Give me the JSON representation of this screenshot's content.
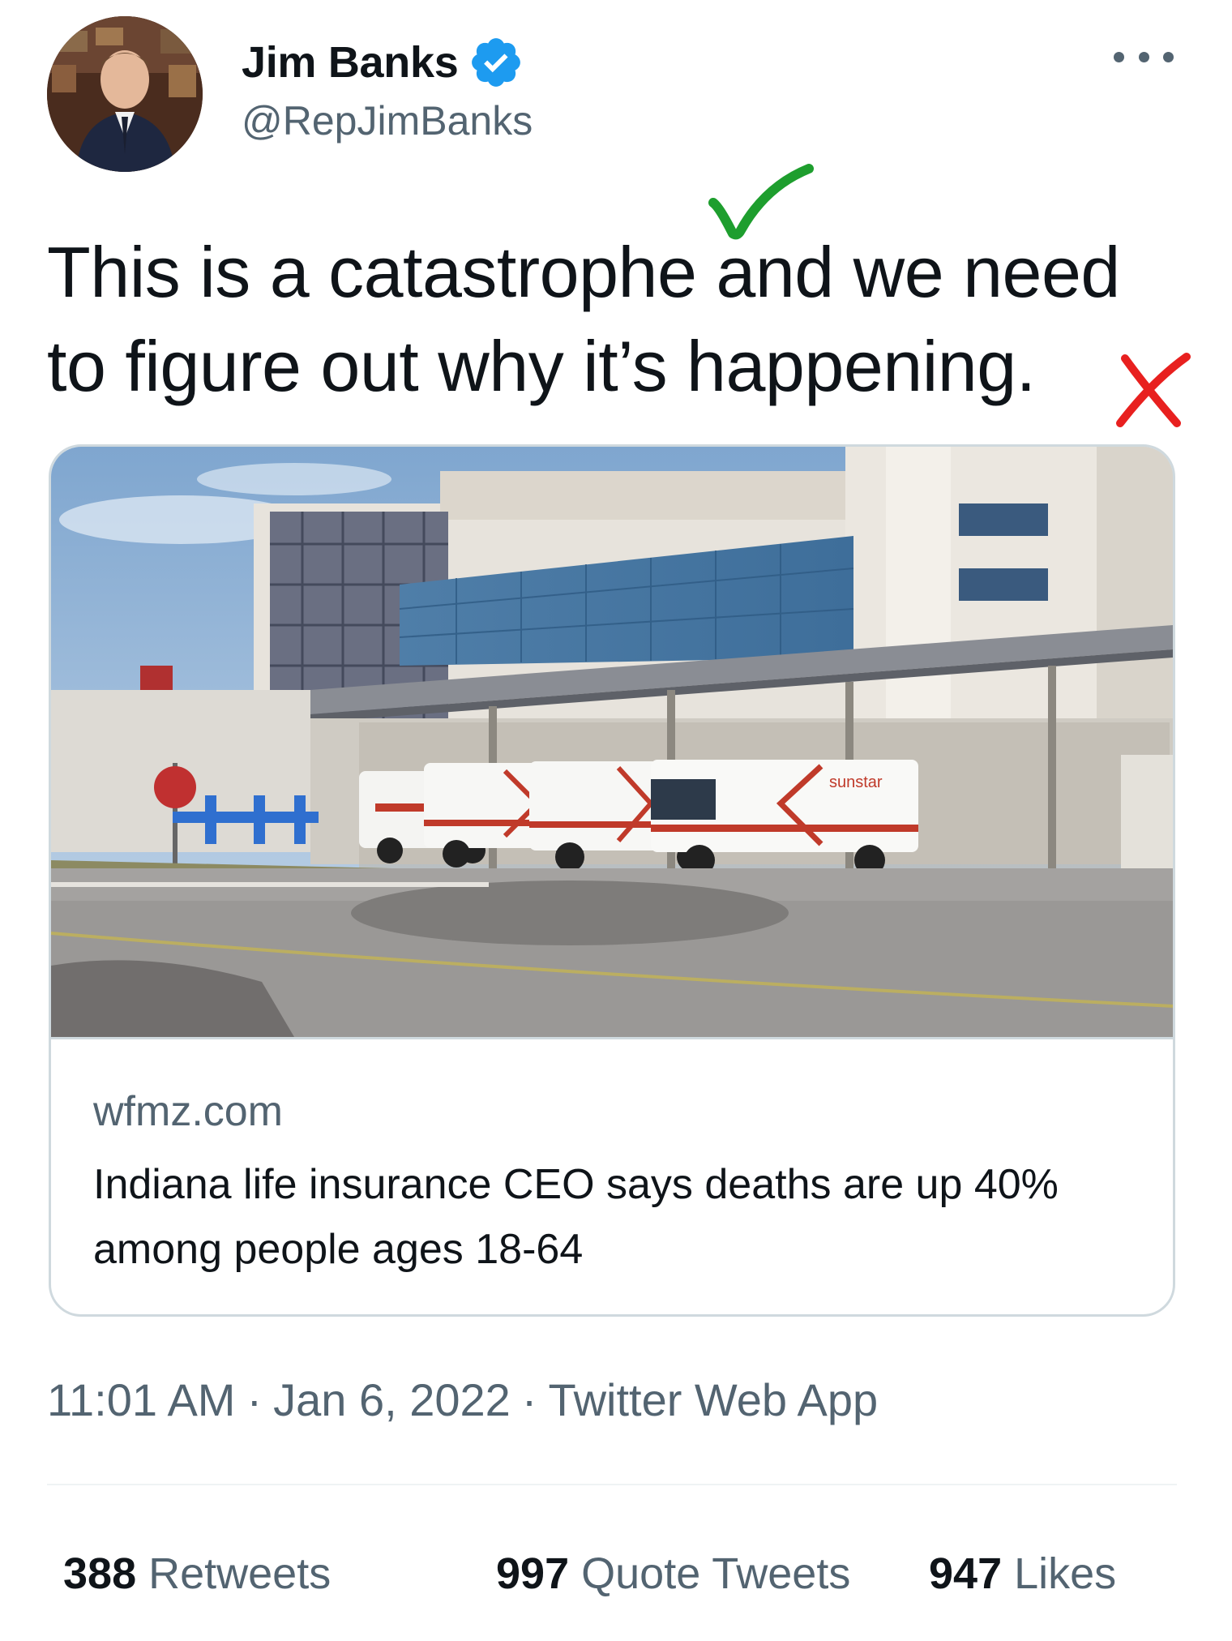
{
  "author": {
    "display_name": "Jim Banks",
    "handle": "@RepJimBanks",
    "verified": true,
    "verified_color": "#1d9bf0"
  },
  "tweet": {
    "text": "This is a catastrophe and we need to figure out why it’s happening."
  },
  "annotations": {
    "checkmark_color": "#1e9e2e",
    "x_mark_color": "#e8201f"
  },
  "link_card": {
    "domain": "wfmz.com",
    "title": "Indiana life insurance CEO says deaths are up 40% among people ages 18-64",
    "image_sign_text": "sunstar"
  },
  "meta": {
    "time": "11:01 AM",
    "date": "Jan 6, 2022",
    "source": "Twitter Web App",
    "separator": "·"
  },
  "stats": {
    "retweets_count": "388",
    "retweets_label": "Retweets",
    "quotes_count": "997",
    "quotes_label": "Quote Tweets",
    "likes_count": "947",
    "likes_label": "Likes"
  },
  "icons": {
    "more": "more-horizontal-icon",
    "verified": "verified-badge-icon"
  }
}
